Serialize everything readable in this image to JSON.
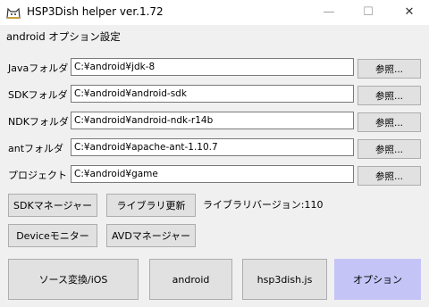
{
  "window": {
    "title": "HSP3Dish helper ver.1.72",
    "minimize_glyph": "—",
    "maximize_glyph": "☐",
    "close_glyph": "✕",
    "icon": "hsp-cat-icon"
  },
  "section_title": "android オプション設定",
  "paths": [
    {
      "label": "Javaフォルダ",
      "value": "C:¥android¥jdk-8",
      "browse": "参照..."
    },
    {
      "label": "SDKフォルダ",
      "value": "C:¥android¥android-sdk",
      "browse": "参照..."
    },
    {
      "label": "NDKフォルダ",
      "value": "C:¥android¥android-ndk-r14b",
      "browse": "参照..."
    },
    {
      "label": "antフォルダ",
      "value": "C:¥android¥apache-ant-1.10.7",
      "browse": "参照..."
    },
    {
      "label": "プロジェクト",
      "value": "C:¥android¥game",
      "browse": "参照..."
    }
  ],
  "tools": {
    "sdk_manager": "SDKマネージャー",
    "library_update": "ライブラリ更新",
    "library_version": "ライブラリバージョン:110",
    "device_monitor": "Deviceモニター",
    "avd_manager": "AVDマネージャー"
  },
  "tabs": {
    "source_convert": "ソース変換/iOS",
    "android": "android",
    "hsp3dish_js": "hsp3dish.js",
    "options": "オプション"
  },
  "colors": {
    "active_tab": "#c4c4f6",
    "button_face": "#e1e1e1",
    "window_bg": "#f0f0f0"
  }
}
